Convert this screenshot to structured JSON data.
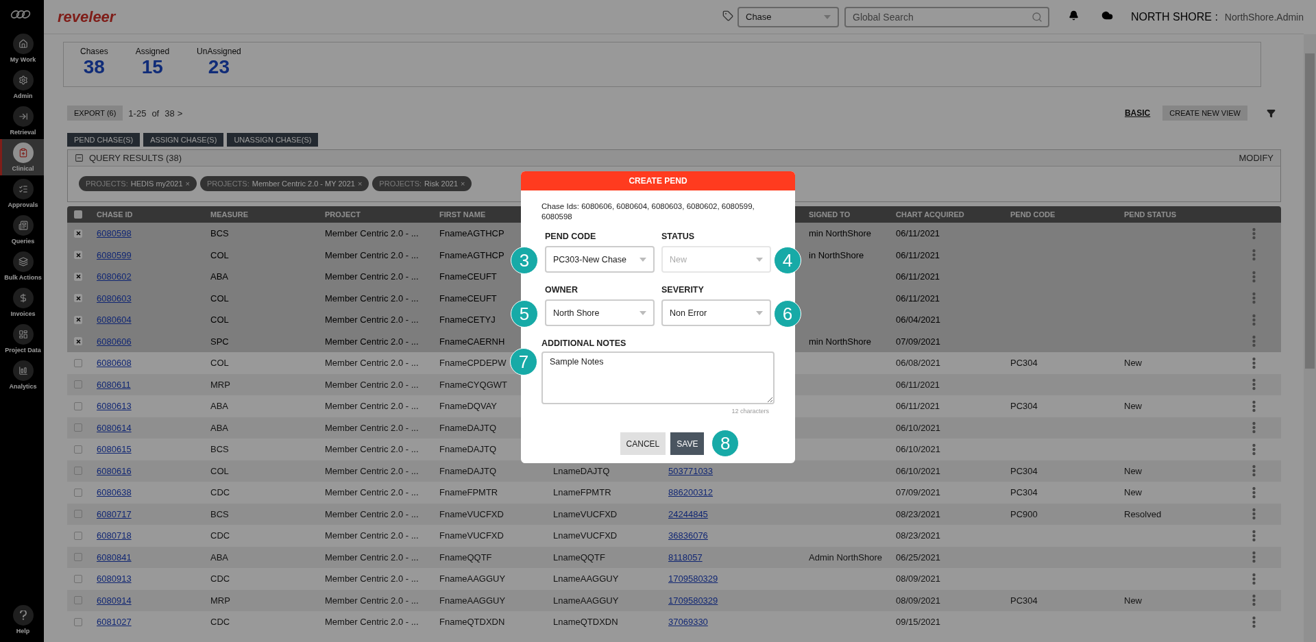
{
  "brand": {
    "name": "reveleer"
  },
  "sidebar": {
    "items": [
      {
        "label": "My Work",
        "selected": false
      },
      {
        "label": "Admin",
        "selected": false
      },
      {
        "label": "Retrieval",
        "selected": false
      },
      {
        "label": "Clinical",
        "selected": true
      },
      {
        "label": "Approvals",
        "selected": false
      },
      {
        "label": "Queries",
        "selected": false
      },
      {
        "label": "Bulk Actions",
        "selected": false
      },
      {
        "label": "Invoices",
        "selected": false
      },
      {
        "label": "Project Data",
        "selected": false
      },
      {
        "label": "Analytics",
        "selected": false
      }
    ],
    "help": "Help"
  },
  "top_bar": {
    "search_type": "Chase",
    "search": {
      "placeholder": "Global Search"
    },
    "org": "NORTH SHORE :",
    "user": "NorthShore.Admin"
  },
  "stats": [
    {
      "label": "Chases",
      "value": "38"
    },
    {
      "label": "Assigned",
      "value": "15"
    },
    {
      "label": "UnAssigned",
      "value": "23"
    }
  ],
  "toolbar": {
    "export": "EXPORT (6)",
    "range": "1-25",
    "of": "of",
    "total": "38",
    "next": ">",
    "view": "BASIC",
    "create_view": "CREATE NEW VIEW"
  },
  "actions": [
    "PEND CHASE(S)",
    "ASSIGN CHASE(S)",
    "UNASSIGN CHASE(S)"
  ],
  "query": {
    "title": "QUERY RESULTS (38)",
    "modify": "MODIFY",
    "chips": [
      {
        "field": "PROJECTS:",
        "value": "HEDIS my2021",
        "remove": "×"
      },
      {
        "field": "PROJECTS:",
        "value": "Member Centric 2.0 - MY 2021",
        "remove": "×"
      },
      {
        "field": "PROJECTS:",
        "value": "Risk 2021",
        "remove": "×"
      }
    ]
  },
  "table": {
    "select_all_checked": false,
    "columns": [
      "CHASE ID",
      "MEASURE",
      "PROJECT",
      "FIRST NAME",
      null,
      null,
      "SIGNED TO",
      "CHART ACQUIRED",
      "PEND CODE",
      "PEND STATUS"
    ],
    "rows": [
      {
        "selected": true,
        "cells": [
          "6080598",
          "BCS",
          "Member Centric 2.0 - ...",
          "FnameAGTHCP",
          null,
          null,
          "min NorthShore",
          "06/11/2021",
          null,
          null
        ]
      },
      {
        "selected": true,
        "cells": [
          "6080599",
          "COL",
          "Member Centric 2.0 - ...",
          "FnameAGTHCP",
          null,
          null,
          "in NorthShore",
          "06/11/2021",
          null,
          null
        ]
      },
      {
        "selected": true,
        "cells": [
          "6080602",
          "ABA",
          "Member Centric 2.0 - ...",
          "FnameCEUFT",
          null,
          null,
          null,
          "06/11/2021",
          null,
          null
        ]
      },
      {
        "selected": true,
        "cells": [
          "6080603",
          "COL",
          "Member Centric 2.0 - ...",
          "FnameCEUFT",
          null,
          null,
          null,
          "06/11/2021",
          null,
          null
        ]
      },
      {
        "selected": true,
        "cells": [
          "6080604",
          "COL",
          "Member Centric 2.0 - ...",
          "FnameCETYJ",
          null,
          null,
          null,
          "06/04/2021",
          null,
          null
        ]
      },
      {
        "selected": true,
        "cells": [
          "6080606",
          "SPC",
          "Member Centric 2.0 - ...",
          "FnameCAERNH",
          null,
          null,
          "min NorthShore",
          "07/09/2021",
          null,
          null
        ]
      },
      {
        "selected": false,
        "cells": [
          "6080608",
          "COL",
          "Member Centric 2.0 - ...",
          "FnameCPDEPW",
          null,
          null,
          null,
          "06/08/2021",
          "PC304",
          "New"
        ]
      },
      {
        "selected": false,
        "cells": [
          "6080611",
          "MRP",
          "Member Centric 2.0 - ...",
          "FnameCYQGWT",
          null,
          null,
          null,
          "06/11/2021",
          null,
          null
        ]
      },
      {
        "selected": false,
        "cells": [
          "6080613",
          "ABA",
          "Member Centric 2.0 - ...",
          "FnameDQVAY",
          null,
          null,
          null,
          "06/11/2021",
          "PC304",
          "New"
        ]
      },
      {
        "selected": false,
        "cells": [
          "6080614",
          "ABA",
          "Member Centric 2.0 - ...",
          "FnameDAJTQ",
          null,
          null,
          null,
          "06/10/2021",
          null,
          null
        ]
      },
      {
        "selected": false,
        "cells": [
          "6080615",
          "BCS",
          "Member Centric 2.0 - ...",
          "FnameDAJTQ",
          null,
          null,
          null,
          "06/10/2021",
          null,
          null
        ]
      },
      {
        "selected": false,
        "cells": [
          "6080616",
          "COL",
          "Member Centric 2.0 - ...",
          "FnameDAJTQ",
          "LnameDAJTQ",
          "503771033",
          null,
          "06/10/2021",
          "PC304",
          "New"
        ]
      },
      {
        "selected": false,
        "cells": [
          "6080638",
          "CDC",
          "Member Centric 2.0 - ...",
          "FnameFPMTR",
          "LnameFPMTR",
          "886200312",
          null,
          "07/09/2021",
          "PC304",
          "New"
        ]
      },
      {
        "selected": false,
        "cells": [
          "6080717",
          "BCS",
          "Member Centric 2.0 - ...",
          "FnameVUCFXD",
          "LnameVUCFXD",
          "24244845",
          null,
          "08/23/2021",
          "PC900",
          "Resolved"
        ]
      },
      {
        "selected": false,
        "cells": [
          "6080718",
          "CDC",
          "Member Centric 2.0 - ...",
          "FnameVUCFXD",
          "LnameVUCFXD",
          "36836076",
          null,
          "08/23/2021",
          null,
          null
        ]
      },
      {
        "selected": false,
        "cells": [
          "6080841",
          "ABA",
          "Member Centric 2.0 - ...",
          "FnameQQTF",
          "LnameQQTF",
          "8118057",
          "Admin NorthShore",
          "06/25/2021",
          null,
          null
        ]
      },
      {
        "selected": false,
        "cells": [
          "6080913",
          "CDC",
          "Member Centric 2.0 - ...",
          "FnameAAGGUY",
          "LnameAAGGUY",
          "1709580329",
          null,
          "08/09/2021",
          null,
          null
        ]
      },
      {
        "selected": false,
        "cells": [
          "6080914",
          "MRP",
          "Member Centric 2.0 - ...",
          "FnameAAGGUY",
          "LnameAAGGUY",
          "1709580329",
          null,
          "08/09/2021",
          "PC304",
          "New"
        ]
      },
      {
        "selected": false,
        "cells": [
          "6081027",
          "CDC",
          "Member Centric 2.0 - ...",
          "FnameQTDXDN",
          "LnameQTDXDN",
          "37069330",
          null,
          "09/15/2021",
          null,
          null
        ]
      }
    ]
  },
  "modal": {
    "title": "CREATE PEND",
    "chase_ids": "Chase Ids: 6080606, 6080604, 6080603, 6080602, 6080599, 6080598",
    "fields": [
      {
        "label": "PEND CODE",
        "value": "PC303-New Chase",
        "disabled": false,
        "callout": "3"
      },
      {
        "label": "STATUS",
        "value": "New",
        "disabled": true,
        "callout": "4"
      },
      {
        "label": "OWNER",
        "value": "North Shore",
        "disabled": false,
        "callout": "5"
      },
      {
        "label": "SEVERITY",
        "value": "Non Error",
        "disabled": false,
        "callout": "6"
      }
    ],
    "notes": {
      "label": "ADDITIONAL NOTES",
      "value": "Sample Notes",
      "count": "12 characters",
      "callout": "7"
    },
    "cancel": "CANCEL",
    "save": "SAVE",
    "save_callout": "8"
  }
}
